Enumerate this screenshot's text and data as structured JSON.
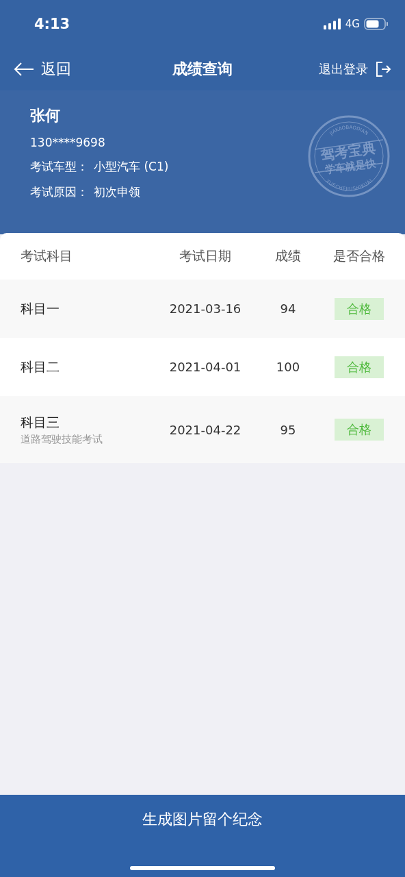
{
  "status_bar": {
    "time": "4:13",
    "network": "4G"
  },
  "nav": {
    "back": "返回",
    "title": "成绩查询",
    "logout": "退出登录"
  },
  "profile": {
    "name": "张何",
    "phone": "130****9698",
    "fields": [
      {
        "label": "考试车型：",
        "value": "小型汽车 (C1)"
      },
      {
        "label": "考试原因：",
        "value": "初次申领"
      }
    ],
    "stamp": {
      "top_arc": "JIAKAOBAODIAN",
      "line_1": "驾考宝典",
      "line_2": "学车就是快",
      "bottom_arc": "XUECHEJIUSHIKUAI"
    }
  },
  "table": {
    "columns": [
      "考试科目",
      "考试日期",
      "成绩",
      "是否合格"
    ],
    "rows": [
      {
        "subject": "科目一",
        "date": "2021-03-16",
        "score": "94",
        "result": "合格",
        "passed": true
      },
      {
        "subject": "科目二",
        "date": "2021-04-01",
        "score": "100",
        "result": "合格",
        "passed": true
      },
      {
        "subject": "科目三",
        "note": "道路驾驶技能考试",
        "date": "2021-04-22",
        "score": "95",
        "result": "合格",
        "passed": true
      }
    ]
  },
  "bottom_button": "生成图片留个纪念"
}
